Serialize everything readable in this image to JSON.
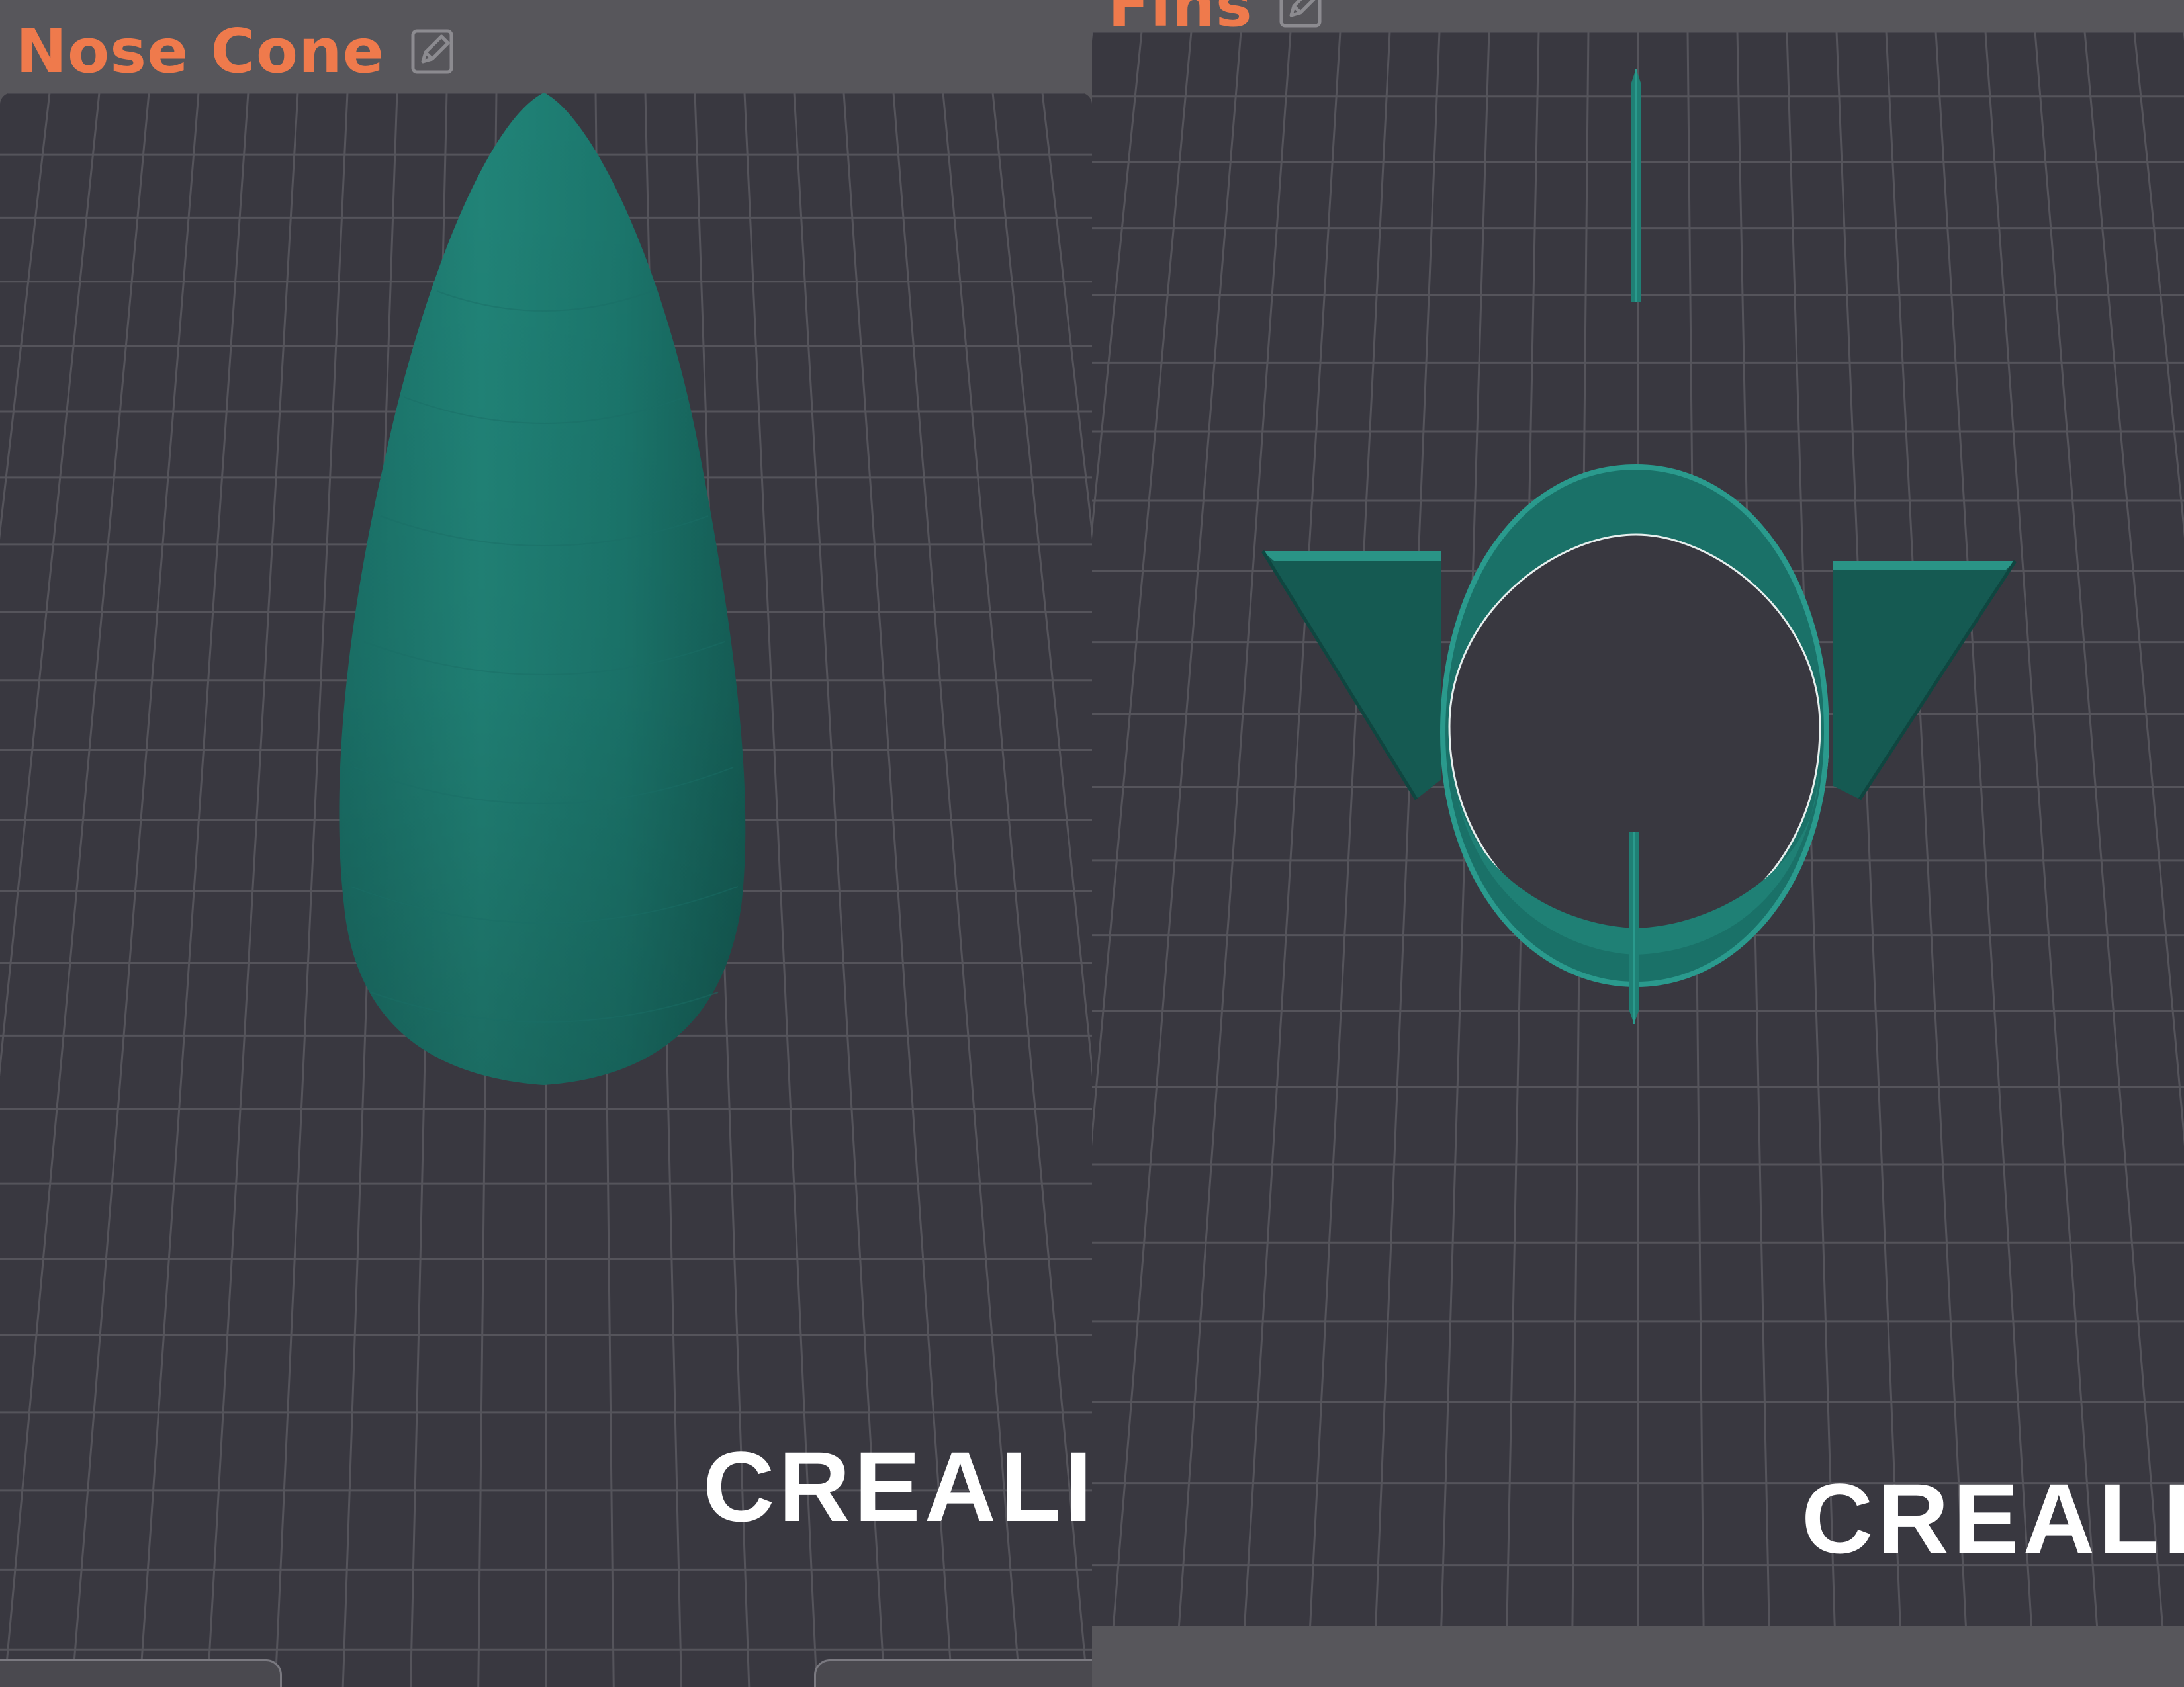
{
  "panels": [
    {
      "title": "Nose Cone",
      "edit_icon": "edit-icon",
      "model": "nose-cone",
      "model_color": "#1f8075",
      "brand_logo_text": "CREALITY",
      "axis_indicator": "x-axis-arrow"
    },
    {
      "title": "Fins",
      "edit_icon": "edit-icon",
      "model": "fin-ring",
      "model_color": "#1f8075",
      "brand_logo_text": "CREALITY",
      "axis_indicator": "x-axis-arrow"
    }
  ],
  "colors": {
    "title_accent": "#ef7a4c",
    "viewport_bg": "#393840",
    "grid_line": "#55545b",
    "model_teal": "#1f8075",
    "model_dark": "#155a52",
    "axis_red": "#c81e1e"
  }
}
